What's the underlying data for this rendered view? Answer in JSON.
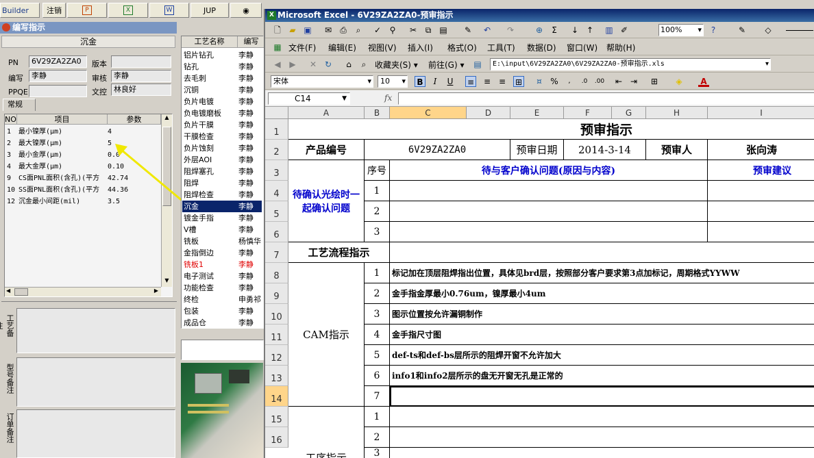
{
  "top": {
    "builder": "Builder",
    "logout": "注销",
    "jup": "JUP"
  },
  "left": {
    "title": "编写指示",
    "section": "沉金",
    "pn_label": "PN",
    "pn_value": "6V29ZA2ZA0",
    "version_label": "版本",
    "version_value": "",
    "author_label": "编写",
    "author_value": "李静",
    "reviewer_label": "审核",
    "reviewer_value": "李静",
    "ppqe_label": "PPQE",
    "ppqe_value": "",
    "docctrl_label": "文控",
    "docctrl_value": "林良好",
    "tab": "常规",
    "grid_headers": [
      "NO",
      "项目",
      "参数"
    ],
    "params": [
      {
        "no": "1",
        "item": "最小镍厚(μm)",
        "val": "4"
      },
      {
        "no": "2",
        "item": "最大镍厚(μm)",
        "val": "5"
      },
      {
        "no": "3",
        "item": "最小金厚(μm)",
        "val": "0.0"
      },
      {
        "no": "4",
        "item": "最大金厚(μm)",
        "val": "0.10"
      },
      {
        "no": "9",
        "item": "CS面PNL面积(含孔)(平方",
        "val": "42.74"
      },
      {
        "no": "10",
        "item": "SS面PNL面积(含孔)(平方",
        "val": "44.36"
      },
      {
        "no": "12",
        "item": "沉金最小间距(mil)",
        "val": "3.5"
      }
    ],
    "note1": "工艺备注",
    "note2": "型号备注",
    "note3": "订单备注"
  },
  "process": {
    "headers": [
      "工艺名称",
      "编写"
    ],
    "rows": [
      {
        "name": "铝片钻孔",
        "by": "李静"
      },
      {
        "name": "钻孔",
        "by": "李静"
      },
      {
        "name": "去毛刺",
        "by": "李静"
      },
      {
        "name": "沉铜",
        "by": "李静"
      },
      {
        "name": "负片电镀",
        "by": "李静"
      },
      {
        "name": "负电镀磨板",
        "by": "李静"
      },
      {
        "name": "负片干膜",
        "by": "李静"
      },
      {
        "name": "干膜检查",
        "by": "李静"
      },
      {
        "name": "负片蚀刻",
        "by": "李静"
      },
      {
        "name": "外层AOI",
        "by": "李静"
      },
      {
        "name": "阻焊塞孔",
        "by": "李静"
      },
      {
        "name": "阻焊",
        "by": "李静"
      },
      {
        "name": "阻焊检查",
        "by": "李静"
      },
      {
        "name": "沉金",
        "by": "李静"
      },
      {
        "name": "镀金手指",
        "by": "李静"
      },
      {
        "name": "V槽",
        "by": "李静"
      },
      {
        "name": "铣板",
        "by": "杨慎华"
      },
      {
        "name": "金指倒边",
        "by": "李静"
      },
      {
        "name": "铣板1",
        "by": "李静"
      },
      {
        "name": "电子测试",
        "by": "李静"
      },
      {
        "name": "功能检查",
        "by": "李静"
      },
      {
        "name": "终检",
        "by": "申勇祁"
      },
      {
        "name": "包装",
        "by": "李静"
      },
      {
        "name": "成品仓",
        "by": "李静"
      }
    ]
  },
  "excel": {
    "title": "Microsoft Excel - 6V29ZA2ZA0-预审指示",
    "menus": [
      "文件(F)",
      "编辑(E)",
      "视图(V)",
      "插入(I)",
      "格式(O)",
      "工具(T)",
      "数据(D)",
      "窗口(W)",
      "帮助(H)"
    ],
    "zoom": "100%",
    "favorites": "收藏夹(S)",
    "goto": "前往(G)",
    "path": "E:\\input\\6V29ZA2ZA0\\6V29ZA2ZA0-预审指示.xls",
    "font": "宋体",
    "size": "10",
    "namebox": "C14",
    "fx": "fx",
    "cols": [
      "A",
      "B",
      "C",
      "D",
      "E",
      "F",
      "G",
      "H",
      "I"
    ],
    "rows": [
      "1",
      "2",
      "3",
      "4",
      "5",
      "6",
      "7",
      "8",
      "9",
      "10",
      "11",
      "12",
      "13",
      "14",
      "15",
      "16"
    ],
    "sheet_title": "预审指示",
    "r2": [
      "产品编号",
      "6V29ZA2ZA0",
      "预审日期",
      "2014-3-14",
      "预审人",
      "张向涛"
    ],
    "r3_seq": "序号",
    "r3_q": "待与客户确认问题(原因与内容)",
    "r3_s": "预审建议",
    "confirm_label": "待确认光绘时一起确认问题",
    "nums": [
      "1",
      "2",
      "3"
    ],
    "flow_label": "工艺流程指示",
    "cam_label": "CAM指示",
    "cam_items": [
      {
        "n": "1",
        "t": "标记加在顶层阻焊指出位置，具体见brd层，按照部分客户要求第3点加标记，周期格式YYWW"
      },
      {
        "n": "2",
        "t": "金手指金厚最小0.76um，镍厚最小4um"
      },
      {
        "n": "3",
        "t": "图示位置按允许漏铜制作"
      },
      {
        "n": "4",
        "t": "金手指尺寸图"
      },
      {
        "n": "5",
        "t": "def-ts和def-bs层所示的阻焊开窗不允许加大"
      },
      {
        "n": "6",
        "t": "info1和info2层所示的盘无开窗无孔是正常的"
      },
      {
        "n": "7",
        "t": ""
      }
    ],
    "proc_label": "工序指示",
    "proc_nums": [
      "1",
      "2",
      "3"
    ]
  }
}
